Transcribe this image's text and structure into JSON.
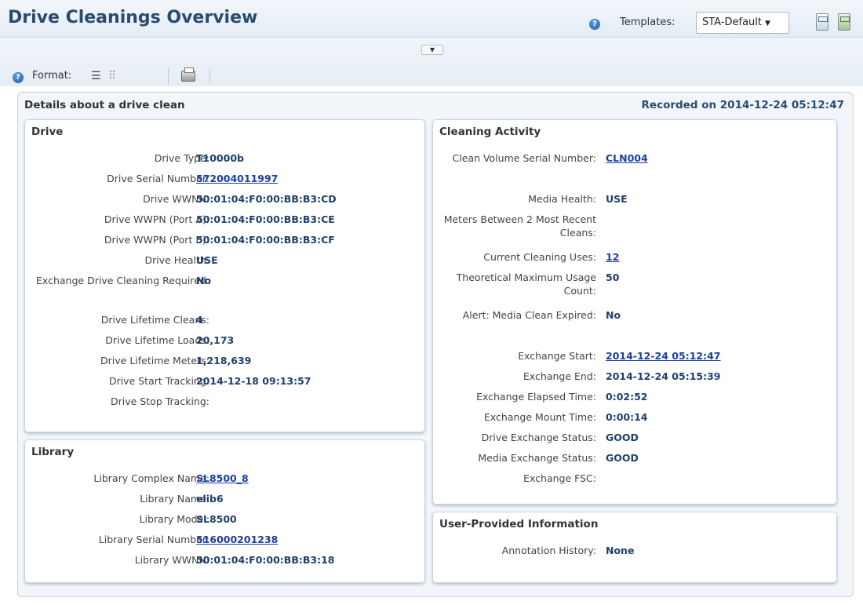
{
  "header": {
    "title": "Drive Cleanings Overview",
    "help_icon": "help-icon",
    "templates_label": "Templates:",
    "template_selected": "STA-Default",
    "save_icon": "save-template-icon",
    "saveas_icon": "save-as-template-icon"
  },
  "toolbar": {
    "help_icon": "help-icon",
    "format_label": "Format:",
    "list_glyph": "☰",
    "grid_glyph": "⠿",
    "print_icon": "print-icon",
    "collapse_glyph": "▼"
  },
  "details": {
    "heading": "Details about a drive clean",
    "recorded": "Recorded on 2014-12-24 05:12:47"
  },
  "drive": {
    "heading": "Drive",
    "rows": [
      {
        "label": "Drive Type:",
        "value": "T10000b",
        "link": false
      },
      {
        "label": "Drive Serial Number:",
        "value": "572004011997",
        "link": true
      },
      {
        "label": "Drive WWNN:",
        "value": "50:01:04:F0:00:BB:B3:CD",
        "link": false
      },
      {
        "label": "Drive WWPN (Port A):",
        "value": "50:01:04:F0:00:BB:B3:CE",
        "link": false
      },
      {
        "label": "Drive WWPN (Port B):",
        "value": "50:01:04:F0:00:BB:B3:CF",
        "link": false
      },
      {
        "label": "Drive Health:",
        "value": "USE",
        "link": false
      },
      {
        "label": "Exchange Drive Cleaning Required:",
        "value": "No",
        "link": false
      },
      {
        "label": "Drive Lifetime Cleans:",
        "value": "4",
        "link": false
      },
      {
        "label": "Drive Lifetime Loads:",
        "value": "20,173",
        "link": false
      },
      {
        "label": "Drive Lifetime Meters:",
        "value": "1,218,639",
        "link": false
      },
      {
        "label": "Drive Start Tracking:",
        "value": "2014-12-18 09:13:57",
        "link": false
      },
      {
        "label": "Drive Stop Tracking:",
        "value": "",
        "link": false
      }
    ]
  },
  "library": {
    "heading": "Library",
    "rows": [
      {
        "label": "Library Complex Name:",
        "value": "SL8500_8",
        "link": true
      },
      {
        "label": "Library Name:",
        "value": "elib6",
        "link": false
      },
      {
        "label": "Library Model:",
        "value": "SL8500",
        "link": false
      },
      {
        "label": "Library Serial Number:",
        "value": "516000201238",
        "link": true
      },
      {
        "label": "Library WWNN:",
        "value": "50:01:04:F0:00:BB:B3:18",
        "link": false
      }
    ]
  },
  "cleaning": {
    "heading": "Cleaning Activity",
    "rows": [
      {
        "label": "Clean Volume Serial Number:",
        "value": "CLN004",
        "link": true
      },
      {
        "label": "Media Health:",
        "value": "USE",
        "link": false
      },
      {
        "label": "Meters Between 2 Most Recent Cleans:",
        "value": "",
        "link": false
      },
      {
        "label": "Current Cleaning Uses:",
        "value": "12",
        "link": true
      },
      {
        "label": "Theoretical Maximum Usage Count:",
        "value": "50",
        "link": false
      },
      {
        "label": "Alert: Media Clean Expired:",
        "value": "No",
        "link": false
      },
      {
        "label": "Exchange Start:",
        "value": "2014-12-24 05:12:47",
        "link": true
      },
      {
        "label": "Exchange End:",
        "value": "2014-12-24 05:15:39",
        "link": false
      },
      {
        "label": "Exchange Elapsed Time:",
        "value": "0:02:52",
        "link": false
      },
      {
        "label": "Exchange Mount Time:",
        "value": "0:00:14",
        "link": false
      },
      {
        "label": "Drive Exchange Status:",
        "value": "GOOD",
        "link": false
      },
      {
        "label": "Media Exchange Status:",
        "value": "GOOD",
        "link": false
      },
      {
        "label": "Exchange FSC:",
        "value": "",
        "link": false
      }
    ]
  },
  "user_info": {
    "heading": "User-Provided Information",
    "rows": [
      {
        "label": "Annotation History:",
        "value": "None",
        "link": false
      }
    ]
  }
}
